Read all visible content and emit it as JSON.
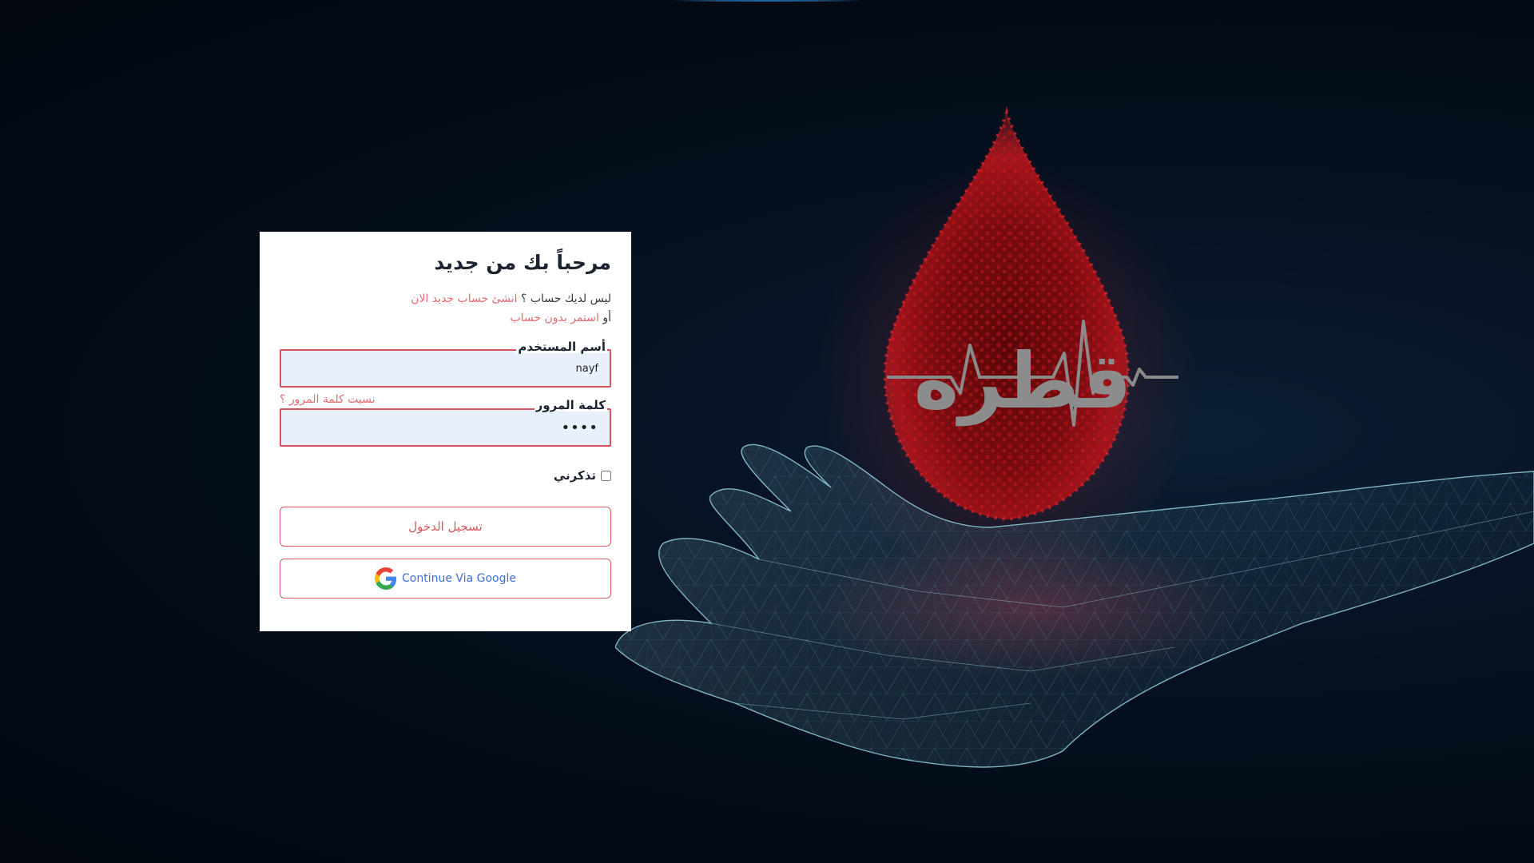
{
  "login": {
    "title": "مرحباً بك من جديد",
    "no_account_text": "ليس لديك حساب ؟",
    "create_account_link": "انشئ حساب جديد الان",
    "or_text": "أو",
    "guest_link": "استمر بدون حساب",
    "username_label": "أسم المستخدم",
    "username_value": "nayf",
    "password_label": "كلمة المرور",
    "password_value": "••••",
    "forgot_password_link": "نسيت كلمة المرور ؟",
    "remember_label": "تذكرني",
    "login_button": "تسجيل الدخول",
    "google_button": "Continue Via Google",
    "google_icon": "google-g-icon"
  },
  "hero": {
    "logo_text": "قطره",
    "blood_drop_icon": "blood-drop-icon",
    "hand_image": "wireframe-hand"
  },
  "colors": {
    "accent": "#d9535d",
    "link": "#e36a73",
    "input_bg": "#e8f0fe",
    "google_blue": "#3b6fd6",
    "background": "#030a14",
    "drop_red": "#8b0d12"
  }
}
